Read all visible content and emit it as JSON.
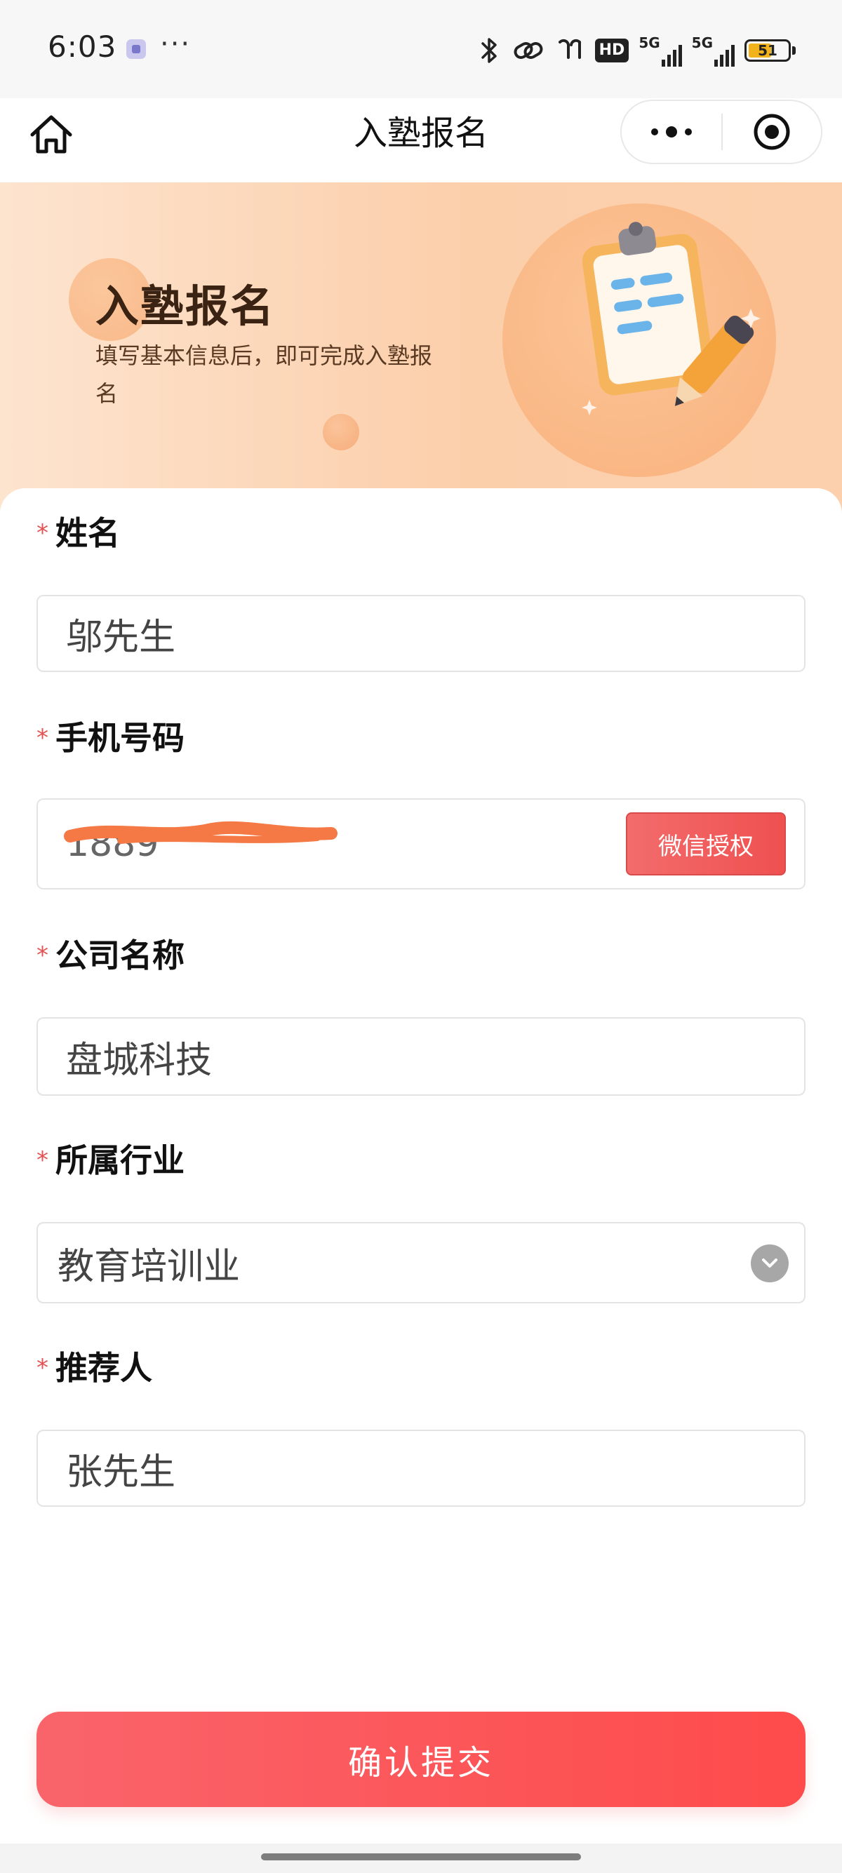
{
  "status_bar": {
    "time": "6:03",
    "dots": "···",
    "hd_badge": "HD",
    "network_label_1": "5G",
    "network_label_2": "5G",
    "battery": "51",
    "icons": [
      "bluetooth-icon",
      "link-icon",
      "earbuds-icon",
      "hd-icon",
      "signal-icon",
      "signal-icon",
      "battery-icon"
    ]
  },
  "nav": {
    "title": "入塾报名",
    "home_icon": "home-icon",
    "more_icon": "more-dots-icon",
    "close_icon": "target-circle-icon"
  },
  "hero": {
    "title": "入塾报名",
    "subtitle": "填写基本信息后，即可完成入塾报名",
    "illustration": "clipboard-pencil-icon"
  },
  "form": {
    "name": {
      "label": "姓名",
      "value": "邬先生"
    },
    "phone": {
      "label": "手机号码",
      "value": "1889",
      "auth_button": "微信授权"
    },
    "company": {
      "label": "公司名称",
      "value": "盘城科技"
    },
    "industry": {
      "label": "所属行业",
      "value": "教育培训业"
    },
    "referrer": {
      "label": "推荐人",
      "value": "张先生"
    },
    "required_mark": "*"
  },
  "submit": {
    "label": "确认提交"
  },
  "colors": {
    "accent": "#f25757",
    "hero_start": "#fde4cf",
    "hero_end": "#fccfab",
    "required": "#e45353"
  }
}
